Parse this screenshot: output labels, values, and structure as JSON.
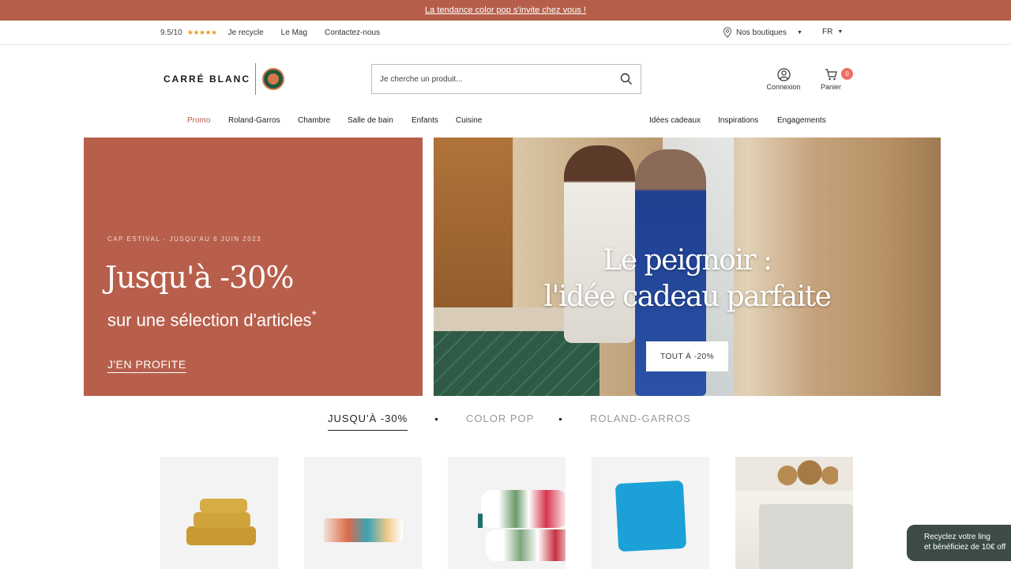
{
  "announcement": {
    "text": "La tendance color pop s'invite chez vous !"
  },
  "utility": {
    "rating": "9.5/10",
    "stars": "★★★★★",
    "links": [
      "Je recycle",
      "Le Mag",
      "Contactez-nous"
    ],
    "stores": "Nos boutiques",
    "lang": "FR"
  },
  "header": {
    "logo_text": "CARRÉ BLANC",
    "search_placeholder": "Je cherche un produit...",
    "account_label": "Connexion",
    "cart_label": "Panier",
    "cart_count": "0"
  },
  "nav": {
    "left": [
      "Promo",
      "Roland-Garros",
      "Chambre",
      "Salle de bain",
      "Enfants",
      "Cuisine"
    ],
    "right": [
      "Idées cadeaux",
      "Inspirations",
      "Engagements"
    ]
  },
  "hero_left": {
    "eyebrow": "CAP ESTIVAL - JUSQU'AU 6 JUIN 2023",
    "title": "Jusqu'à -30%",
    "subtitle": "sur une sélection d'articles",
    "asterisk": "*",
    "cta": "J'EN PROFITE"
  },
  "hero_right": {
    "headline_line1": "Le peignoir :",
    "headline_line2": "l'idée cadeau parfaite",
    "cta": "TOUT À -20%"
  },
  "category_tabs": [
    "JUSQU'À -30%",
    "COLOR POP",
    "ROLAND-GARROS"
  ],
  "recycle_popup": {
    "line1": "Recyclez votre ling",
    "line2": "et bénéficiez de 10€ off"
  },
  "colors": {
    "brand": "#b55f4b",
    "badge": "#ec6d63",
    "stars": "#e99b2c"
  }
}
